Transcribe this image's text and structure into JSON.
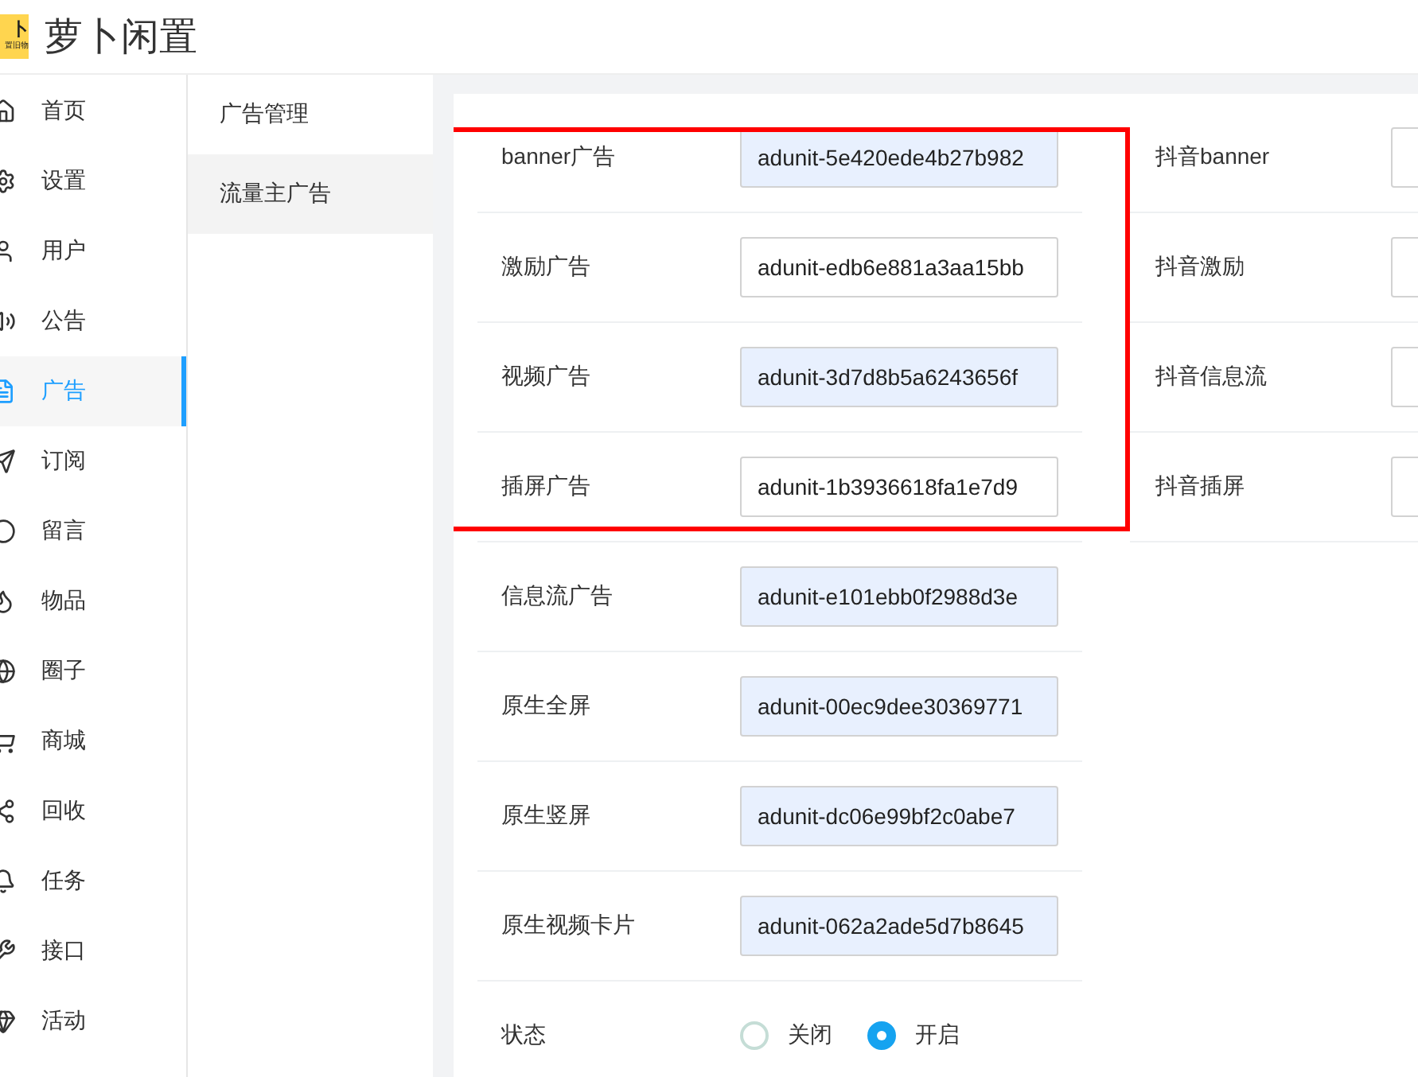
{
  "header": {
    "logo": {
      "mark": "卜",
      "sub": "置旧物"
    },
    "title": "萝卜闲置"
  },
  "sidebar": {
    "items": [
      {
        "label": "首页",
        "selected": false
      },
      {
        "label": "设置",
        "selected": false
      },
      {
        "label": "用户",
        "selected": false
      },
      {
        "label": "公告",
        "selected": false
      },
      {
        "label": "广告",
        "selected": true
      },
      {
        "label": "订阅",
        "selected": false
      },
      {
        "label": "留言",
        "selected": false
      },
      {
        "label": "物品",
        "selected": false
      },
      {
        "label": "圈子",
        "selected": false
      },
      {
        "label": "商城",
        "selected": false
      },
      {
        "label": "回收",
        "selected": false
      },
      {
        "label": "任务",
        "selected": false
      },
      {
        "label": "接口",
        "selected": false
      },
      {
        "label": "活动",
        "selected": false
      }
    ]
  },
  "submenu": {
    "items": [
      {
        "label": "广告管理",
        "selected": false
      },
      {
        "label": "流量主广告",
        "selected": true
      }
    ]
  },
  "form": {
    "left_fields": [
      {
        "label": "banner广告",
        "value": "adunit-5e420ede4b27b982",
        "autofilled": true
      },
      {
        "label": "激励广告",
        "value": "adunit-edb6e881a3aa15bb",
        "autofilled": false
      },
      {
        "label": "视频广告",
        "value": "adunit-3d7d8b5a6243656f",
        "autofilled": true
      },
      {
        "label": "插屏广告",
        "value": "adunit-1b3936618fa1e7d9",
        "autofilled": false
      },
      {
        "label": "信息流广告",
        "value": "adunit-e101ebb0f2988d3e",
        "autofilled": true
      },
      {
        "label": "原生全屏",
        "value": "adunit-00ec9dee30369771",
        "autofilled": true
      },
      {
        "label": "原生竖屏",
        "value": "adunit-dc06e99bf2c0abe7",
        "autofilled": true
      },
      {
        "label": "原生视频卡片",
        "value": "adunit-062a2ade5d7b8645",
        "autofilled": true
      }
    ],
    "status": {
      "label": "状态",
      "options": [
        {
          "label": "关闭",
          "selected": false
        },
        {
          "label": "开启",
          "selected": true
        }
      ]
    },
    "right_fields": [
      {
        "label": "抖音banner"
      },
      {
        "label": "抖音激励"
      },
      {
        "label": "抖音信息流"
      },
      {
        "label": "抖音插屏"
      }
    ]
  }
}
